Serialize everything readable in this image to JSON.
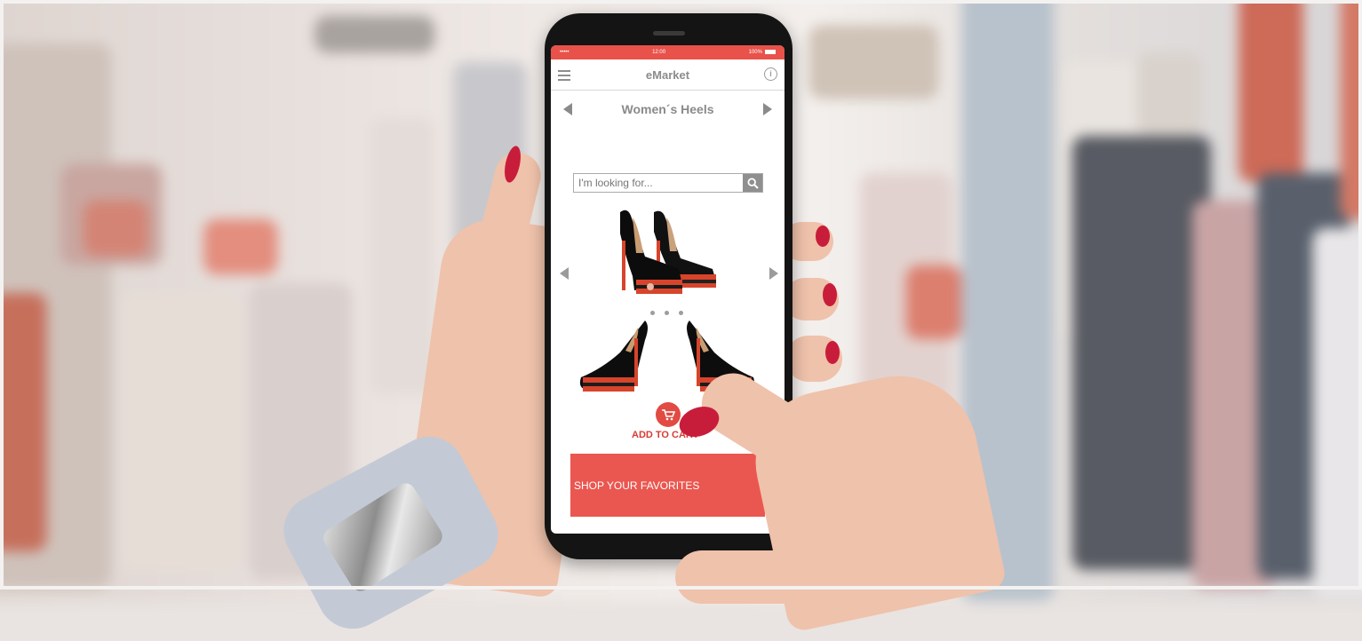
{
  "status_bar": {
    "carrier": "••••• ",
    "time": "12:00",
    "battery": "100%"
  },
  "app": {
    "title": "eMarket"
  },
  "category": {
    "name": "Women´s Heels"
  },
  "search": {
    "placeholder": "I'm looking for..."
  },
  "carousel": {
    "page_count": 3
  },
  "cart": {
    "label": "ADD TO CART"
  },
  "banner": {
    "text": "SHOP YOUR FAVORITES"
  },
  "colors": {
    "accent": "#e8524a",
    "nail": "#c81d3a"
  },
  "icons": [
    "menu-icon",
    "info-icon",
    "search-icon",
    "cart-icon",
    "arrow-left-icon",
    "arrow-right-icon"
  ]
}
